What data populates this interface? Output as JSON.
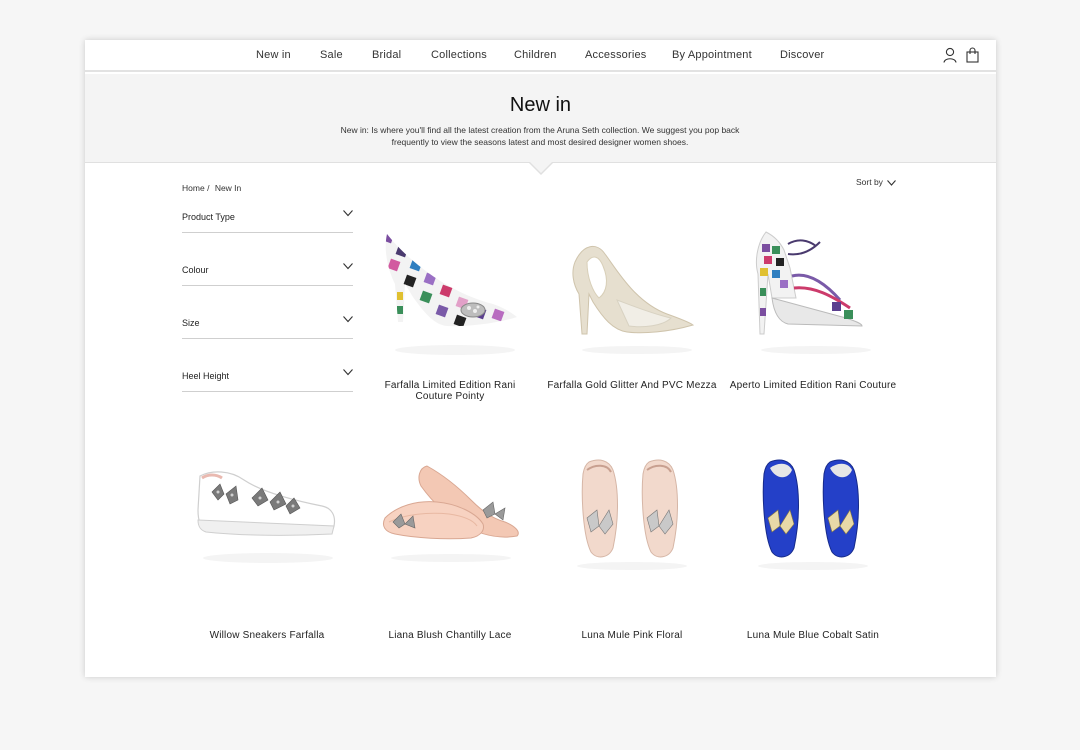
{
  "nav": {
    "items": [
      "New in",
      "Sale",
      "Bridal",
      "Collections",
      "Children",
      "Accessories",
      "By Appointment",
      "Discover"
    ],
    "account_icon": "user-icon",
    "bag_icon": "shopping-bag-icon"
  },
  "hero": {
    "title": "New in",
    "description": "New in: Is where you'll find all the latest creation from the Aruna Seth collection. We suggest you pop back frequently to view the seasons latest and most desired designer women shoes."
  },
  "breadcrumb": [
    "Home",
    "/",
    "New In"
  ],
  "sort": {
    "label": "Sort by"
  },
  "filters": [
    "Product Type",
    "Colour",
    "Size",
    "Heel Height"
  ],
  "products": [
    {
      "name": "Farfalla Limited Edition Rani Couture Pointy"
    },
    {
      "name": "Farfalla Gold Glitter And PVC Mezza"
    },
    {
      "name": "Aperto Limited Edition Rani Couture"
    },
    {
      "name": "Willow Sneakers Farfalla"
    },
    {
      "name": "Liana Blush Chantilly Lace"
    },
    {
      "name": "Luna Mule Pink Floral"
    },
    {
      "name": "Luna Mule Blue Cobalt Satin"
    }
  ],
  "colors": {
    "hero_bg": "#f4f4f4",
    "text": "#222222",
    "divider": "#cfcfcf"
  }
}
